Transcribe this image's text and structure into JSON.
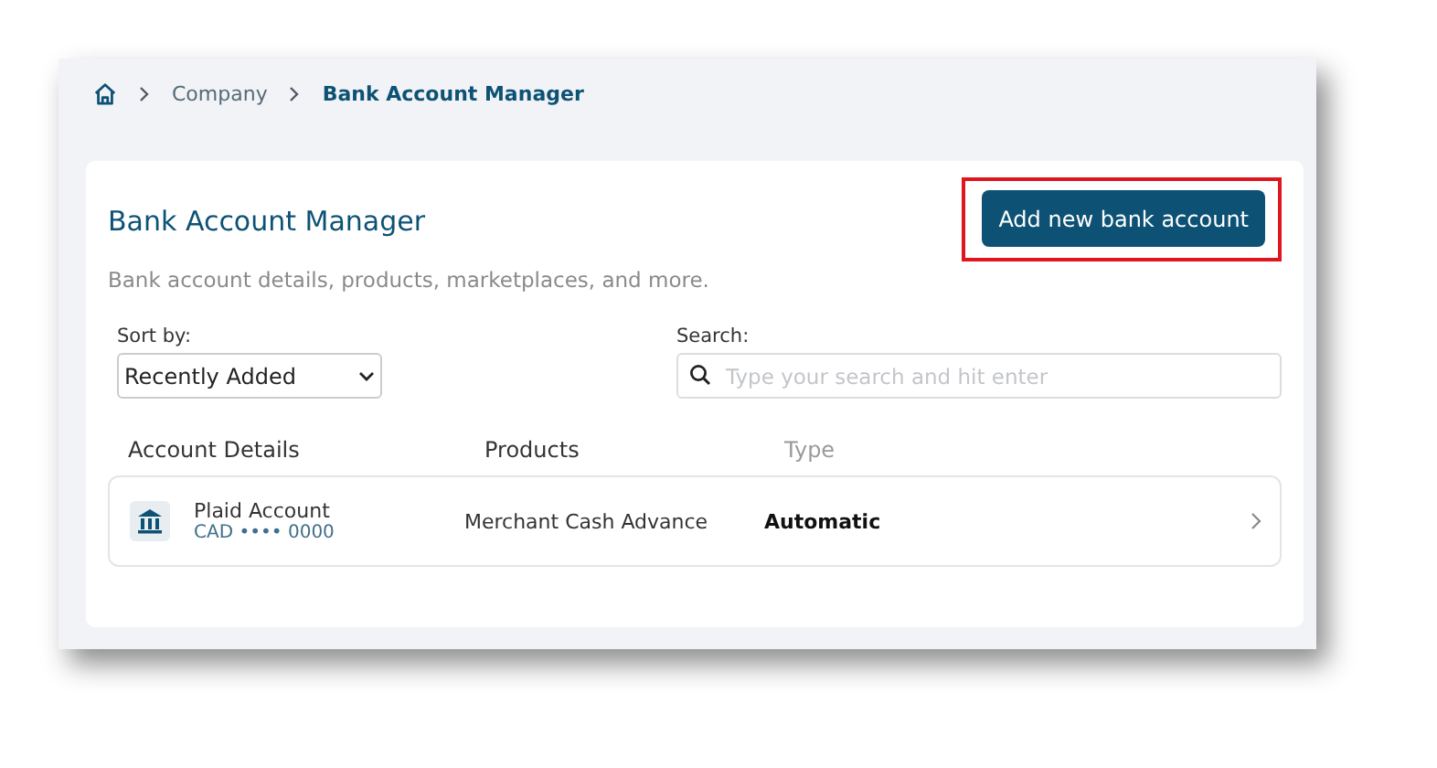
{
  "breadcrumb": [
    {
      "label": "Company",
      "current": false
    },
    {
      "label": "Bank Account Manager",
      "current": true
    }
  ],
  "card": {
    "title": "Bank Account Manager",
    "subtitle": "Bank account details, products, marketplaces, and more.",
    "button": {
      "label": "Add new bank account",
      "highlighted": true
    }
  },
  "sort": {
    "label": "Sort by:",
    "value": "Recently Added"
  },
  "search": {
    "label": "Search:",
    "placeholder": "Type your search and hit enter"
  },
  "table": {
    "columns": [
      {
        "label": "Account Details",
        "muted": false
      },
      {
        "label": "Products",
        "muted": false
      },
      {
        "label": "Type",
        "muted": true
      }
    ],
    "rows": [
      {
        "name": "Plaid Account",
        "account": "CAD •••• 0000",
        "product": "Merchant Cash Advance",
        "type": "Automatic"
      }
    ]
  }
}
